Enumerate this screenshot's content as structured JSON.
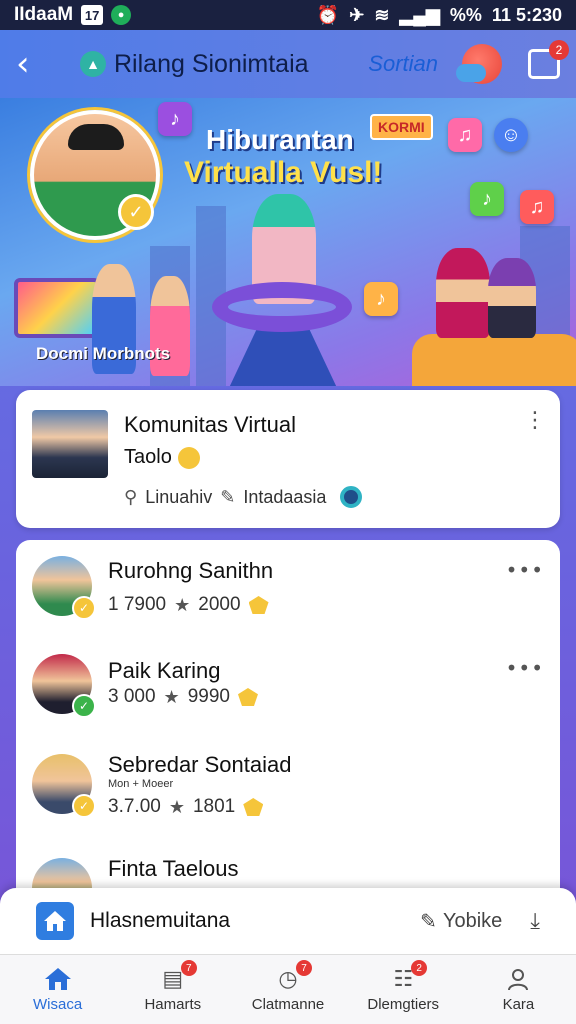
{
  "status_bar": {
    "carrier": "IIdaaM",
    "badge": "17",
    "time": "11 5:230",
    "battery": "%%"
  },
  "header": {
    "title": "Rilang Sionimtaia",
    "action_label": "Sortian",
    "inbox_badge": "2"
  },
  "banner": {
    "title": "Hiburantan",
    "subtitle": "Virtualla Vusl!",
    "tag": "KORMI",
    "caption": "Docmi Morbnots"
  },
  "community": {
    "title": "Komunitas Virtual",
    "subtitle": "Taolo",
    "action_1": "Linuahiv",
    "action_2": "Intadaasia"
  },
  "leaderboard": [
    {
      "name": "Rurohng Sanithn",
      "stat_a": "1 7900",
      "stat_b": "2000",
      "check_color": "#f5c53a"
    },
    {
      "name": "Paik Karing",
      "stat_a": "3 000",
      "stat_b": "9990",
      "check_color": "#3bb34a"
    },
    {
      "name": "Sebredar Sontaiad",
      "sub": "Mon + Moeer",
      "stat_a": "3.7.00",
      "stat_b": "1801",
      "check_color": "#f5c53a"
    },
    {
      "name": "Finta Taelous"
    }
  ],
  "bottom_sheet": {
    "title": "Hlasnemuitana",
    "action_label": "Yobike"
  },
  "tabs": [
    {
      "label": "Wisaca",
      "icon": "home-icon",
      "active": true
    },
    {
      "label": "Hamarts",
      "icon": "calendar-icon",
      "badge": "7"
    },
    {
      "label": "Clatmanne",
      "icon": "alarm-icon",
      "badge": "7"
    },
    {
      "label": "Dlemgtiers",
      "icon": "schedule-icon",
      "badge": "2"
    },
    {
      "label": "Kara",
      "icon": "profile-icon"
    }
  ],
  "colors": {
    "accent": "#2a6ed8",
    "header": "#4f7ce8",
    "gold": "#f5c53a",
    "badge": "#e53935"
  }
}
